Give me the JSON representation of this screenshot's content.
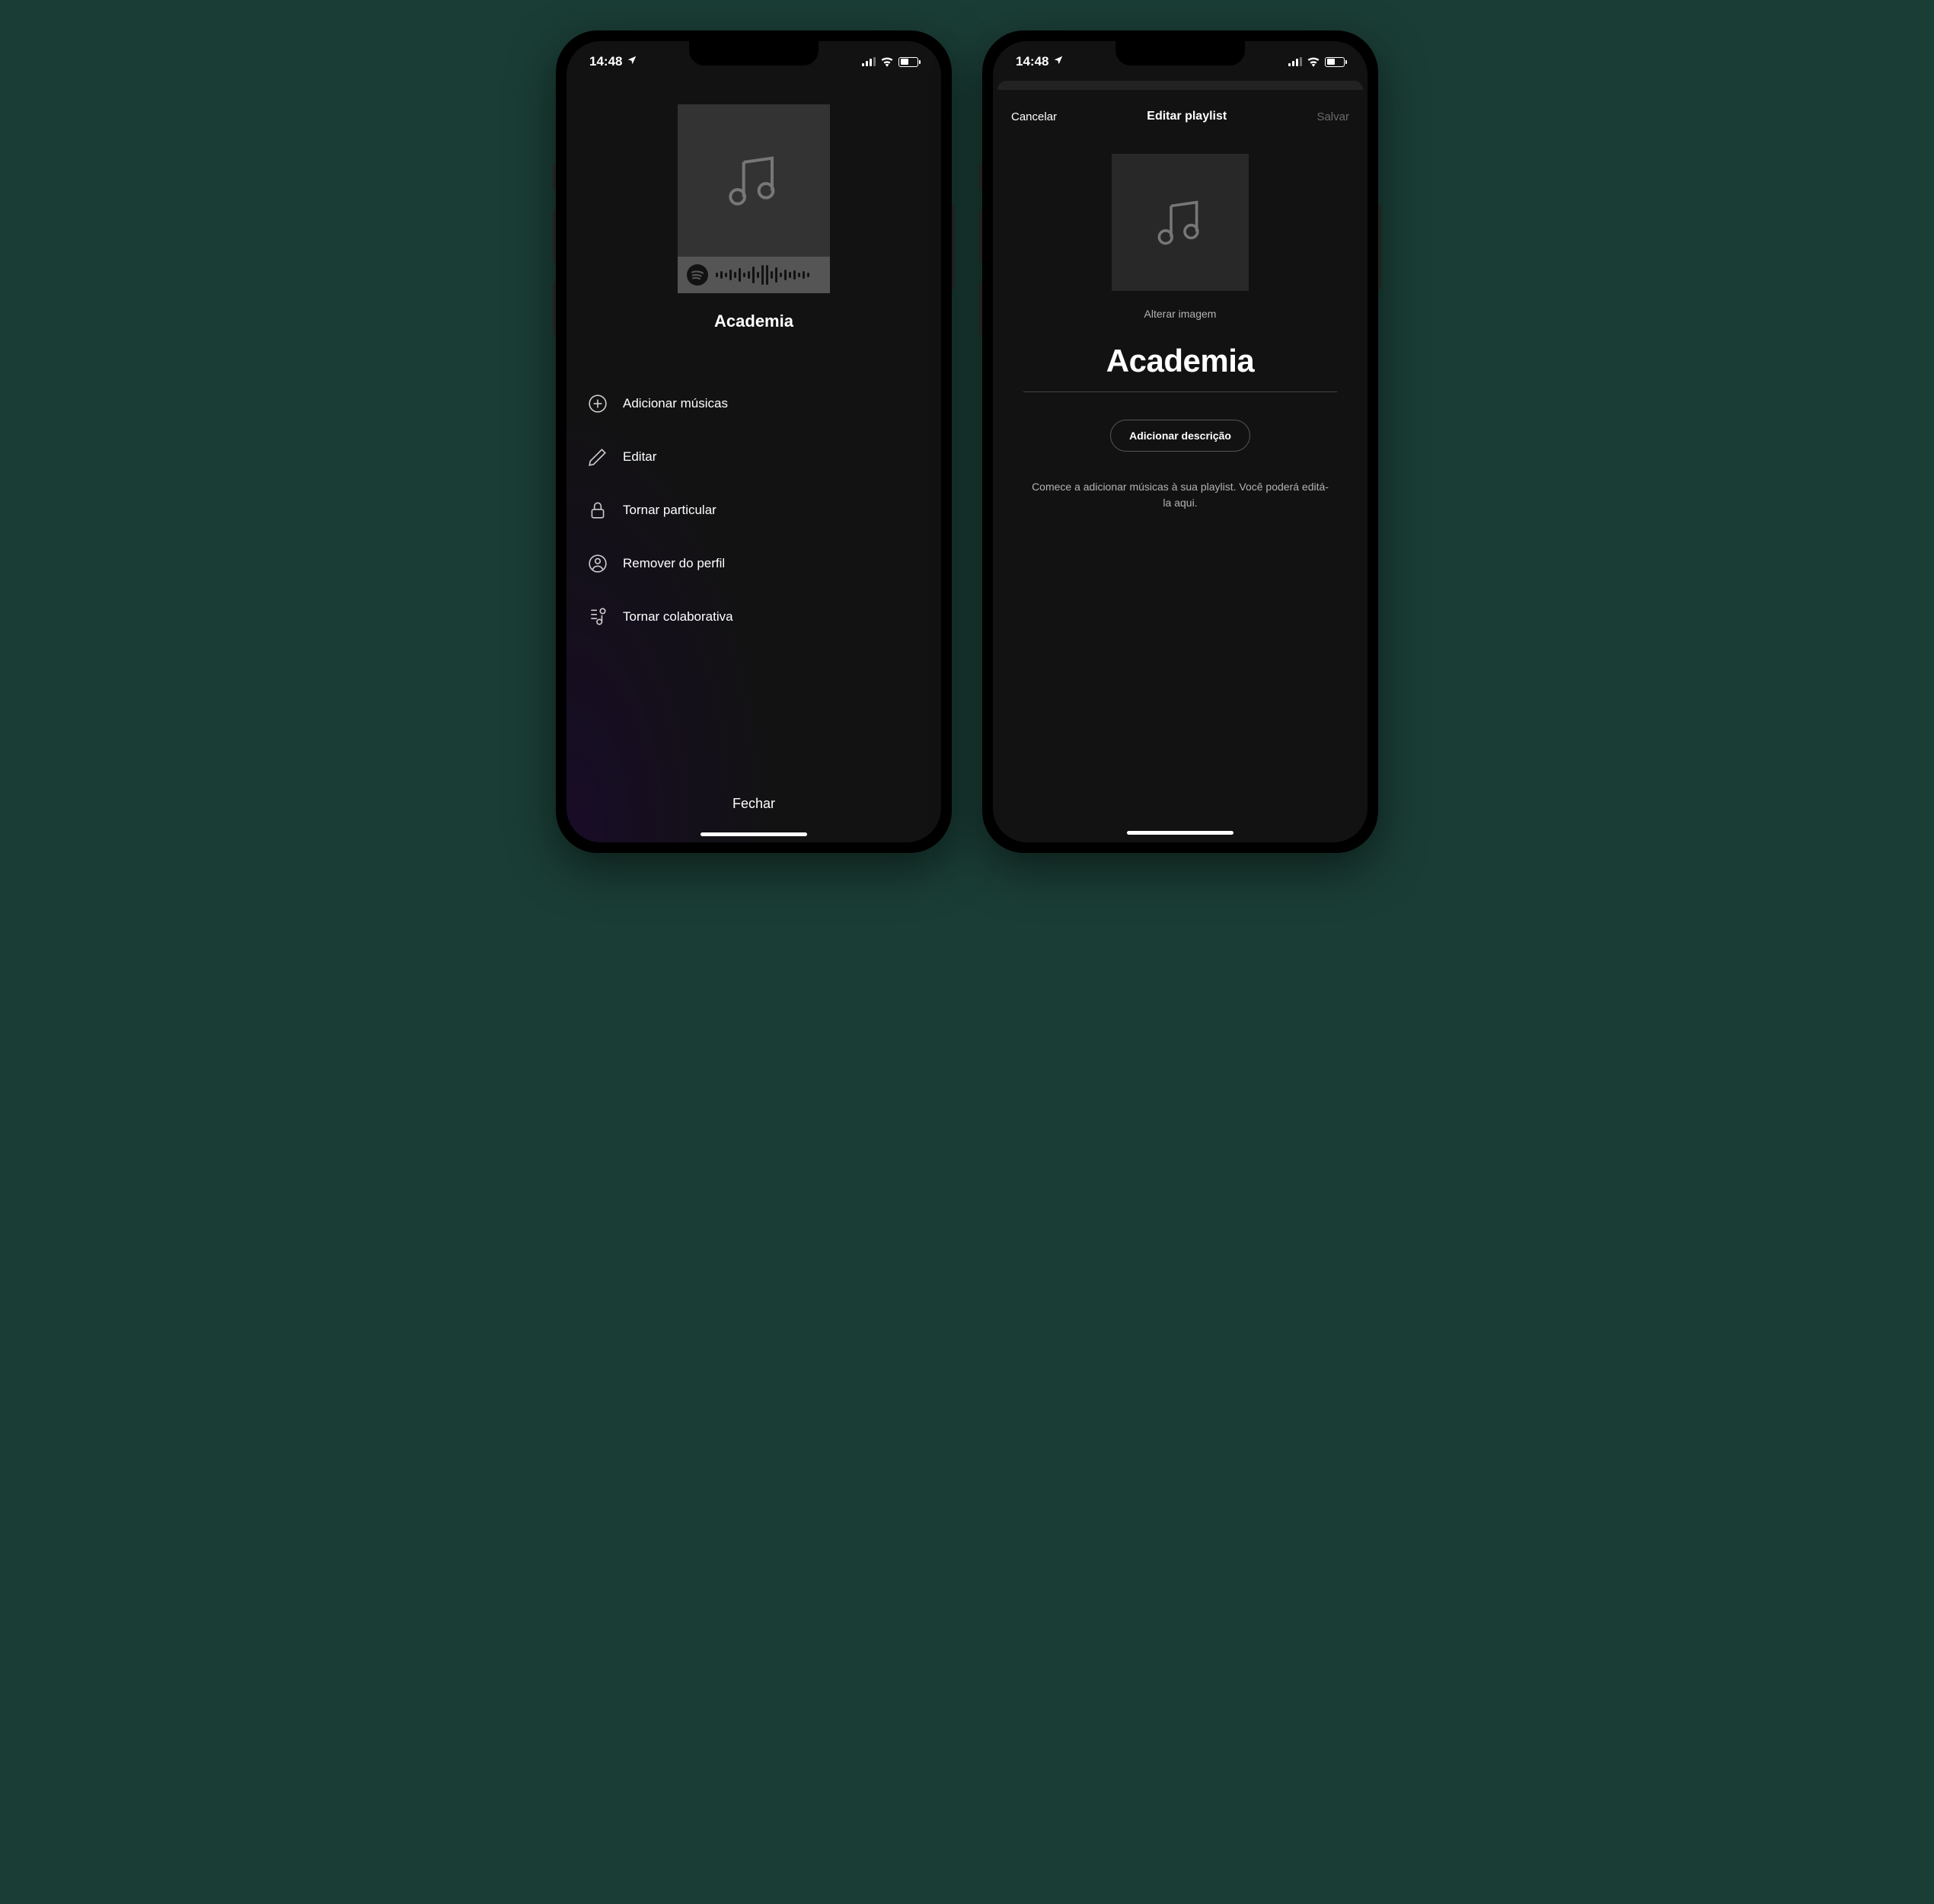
{
  "status": {
    "time": "14:48"
  },
  "screen1": {
    "playlist_title": "Academia",
    "menu": {
      "add_songs": "Adicionar músicas",
      "edit": "Editar",
      "make_private": "Tornar particular",
      "remove_profile": "Remover do perfil",
      "make_collaborative": "Tornar colaborativa"
    },
    "close": "Fechar"
  },
  "screen2": {
    "header": {
      "cancel": "Cancelar",
      "title": "Editar playlist",
      "save": "Salvar"
    },
    "change_image": "Alterar imagem",
    "playlist_name": "Academia",
    "add_description": "Adicionar descrição",
    "hint": "Comece a adicionar músicas à sua playlist. Você poderá editá-la aqui."
  }
}
